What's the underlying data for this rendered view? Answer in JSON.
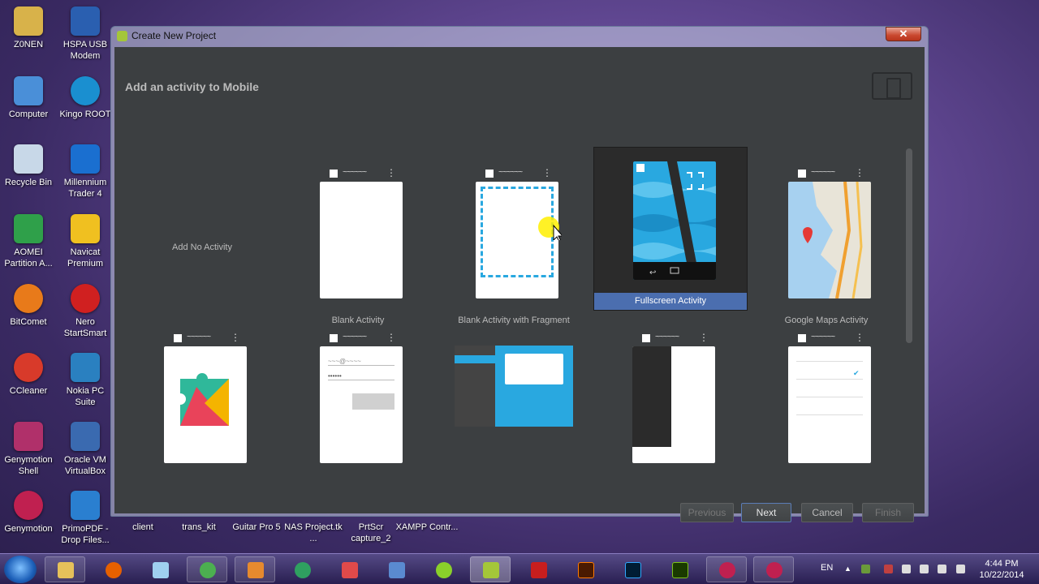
{
  "desktop": {
    "left_col1": [
      {
        "label": "Z0NEN",
        "icon": "folder-icon",
        "color": "#d8b24a"
      },
      {
        "label": "Computer",
        "icon": "computer-icon",
        "color": "#4a8fd8"
      },
      {
        "label": "Recycle Bin",
        "icon": "recycle-bin-icon",
        "color": "#c8d8e8"
      },
      {
        "label": "AOMEI Partition A...",
        "icon": "aomei-icon",
        "color": "#2fa04a"
      },
      {
        "label": "BitComet",
        "icon": "bitcomet-icon",
        "color": "#e87a1a"
      },
      {
        "label": "CCleaner",
        "icon": "ccleaner-icon",
        "color": "#d83a2a"
      },
      {
        "label": "Genymotion Shell",
        "icon": "genymotion-shell-icon",
        "color": "#b0306a"
      },
      {
        "label": "Genymotion",
        "icon": "genymotion-icon",
        "color": "#c02050"
      }
    ],
    "left_col2": [
      {
        "label": "HSPA USB Modem",
        "icon": "modem-icon",
        "color": "#2a5fb0"
      },
      {
        "label": "Kingo ROOT",
        "icon": "kingo-root-icon",
        "color": "#1a8fd0"
      },
      {
        "label": "Millennium Trader 4",
        "icon": "millennium-icon",
        "color": "#1a6fd0"
      },
      {
        "label": "Navicat Premium",
        "icon": "navicat-icon",
        "color": "#f0c020"
      },
      {
        "label": "Nero StartSmart",
        "icon": "nero-icon",
        "color": "#d02020"
      },
      {
        "label": "Nokia PC Suite",
        "icon": "nokia-icon",
        "color": "#2a80c0"
      },
      {
        "label": "Oracle VM VirtualBox",
        "icon": "virtualbox-icon",
        "color": "#3a6ab0"
      },
      {
        "label": "PrimoPDF - Drop Files...",
        "icon": "primopdf-icon",
        "color": "#2a7fd0"
      }
    ],
    "bottom_row": [
      {
        "label": "client"
      },
      {
        "label": "trans_kit"
      },
      {
        "label": "Guitar Pro 5"
      },
      {
        "label": "NAS Project.tk ..."
      },
      {
        "label": "PrtScr capture_2"
      },
      {
        "label": "XAMPP Contr..."
      }
    ]
  },
  "window": {
    "title": "Create New Project",
    "close_label": "✕",
    "heading": "Add an activity to Mobile"
  },
  "gallery": {
    "no_activity_label": "Add No Activity",
    "tiles": [
      {
        "label": "Blank Activity"
      },
      {
        "label": "Blank Activity with Fragment"
      },
      {
        "label": "Fullscreen Activity",
        "selected": true
      },
      {
        "label": "Google Maps Activity"
      }
    ]
  },
  "buttons": {
    "previous": "Previous",
    "next": "Next",
    "cancel": "Cancel",
    "finish": "Finish"
  },
  "taskbar": {
    "language": "EN",
    "time": "4:44 PM",
    "date": "10/22/2014"
  },
  "colors": {
    "dialog_bg": "#3c3f41",
    "selection": "#4b6eaf",
    "fullscreen_blue": "#29a8e0"
  }
}
